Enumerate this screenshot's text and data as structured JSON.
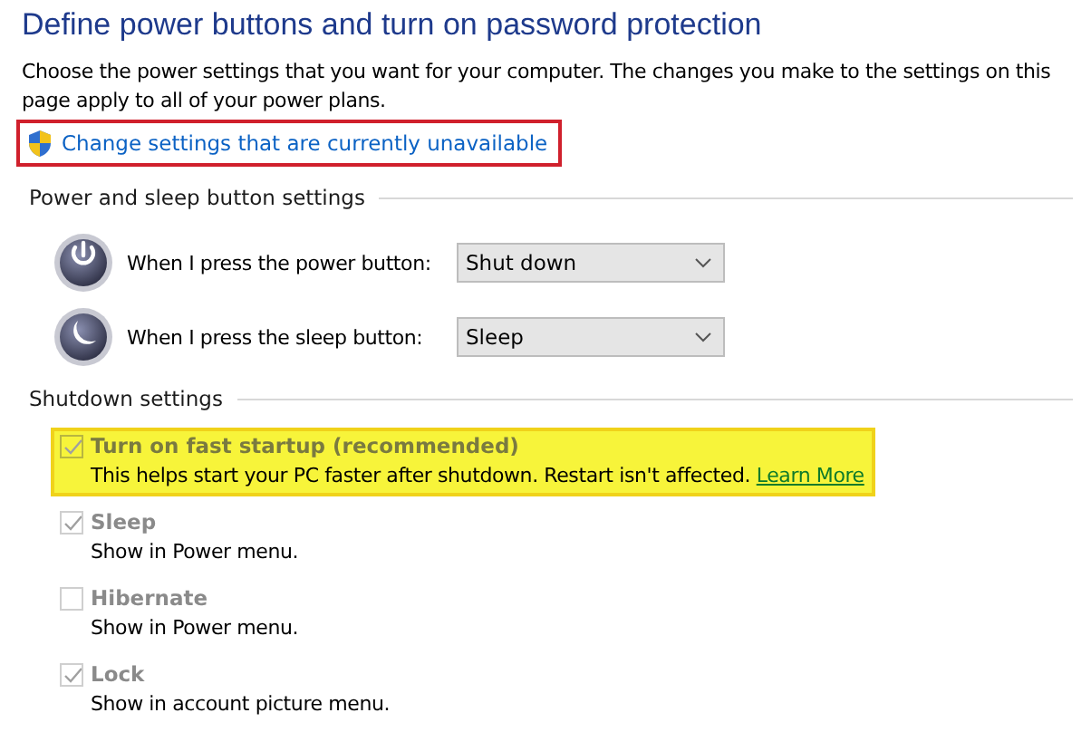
{
  "title": "Define power buttons and turn on password protection",
  "description": "Choose the power settings that you want for your computer. The changes you make to the settings on this page apply to all of your power plans.",
  "admin_link": {
    "label": "Change settings that are currently unavailable",
    "highlighted": true
  },
  "power_section": {
    "heading": "Power and sleep button settings",
    "rows": [
      {
        "kind": "power",
        "label": "When I press the power button:",
        "value": "Shut down"
      },
      {
        "kind": "sleep",
        "label": "When I press the sleep button:",
        "value": "Sleep"
      }
    ]
  },
  "shutdown_section": {
    "heading": "Shutdown settings",
    "options": [
      {
        "label": "Turn on fast startup (recommended)",
        "description": "This helps start your PC faster after shutdown. Restart isn't affected.",
        "link": "Learn More",
        "checked": true,
        "disabled": true,
        "highlighted": true
      },
      {
        "label": "Sleep",
        "description": "Show in Power menu.",
        "checked": true,
        "disabled": true,
        "highlighted": false
      },
      {
        "label": "Hibernate",
        "description": "Show in Power menu.",
        "checked": false,
        "disabled": true,
        "highlighted": false
      },
      {
        "label": "Lock",
        "description": "Show in account picture menu.",
        "checked": true,
        "disabled": true,
        "highlighted": false
      }
    ]
  }
}
